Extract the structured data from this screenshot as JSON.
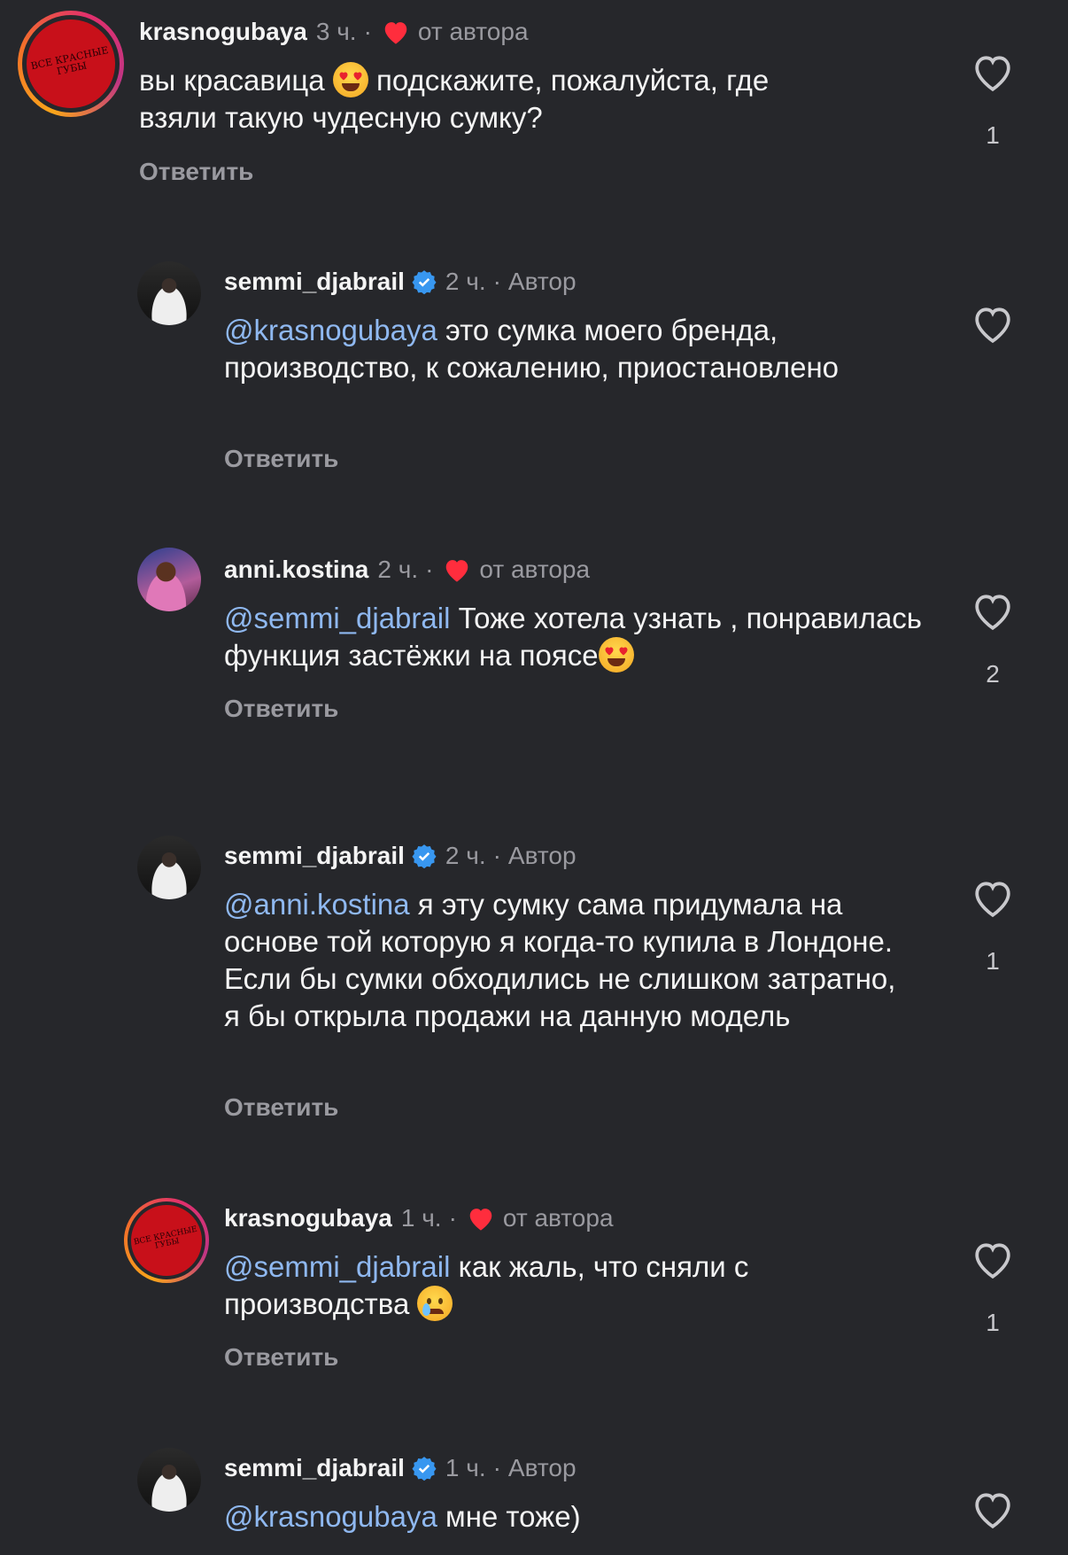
{
  "reply_label": "Ответить",
  "comments": [
    {
      "username": "krasnogubaya",
      "time": "3 ч.",
      "dot": "·",
      "tag": "от автора",
      "avatar_text": "ВСЕ КРАСНЫЕ ГУБЫ",
      "text_before": "вы красавица",
      "emoji": "heart-eyes",
      "text_after": "подскажите, пожалуйста, где взяли такую чудесную сумку?",
      "likes": "1"
    },
    {
      "username": "semmi_djabrail",
      "time": "2 ч.",
      "dot": "·",
      "tag": "Автор",
      "mention": "@krasnogubaya",
      "text": "это сумка моего бренда, производство, к сожалению, приостановлено",
      "likes": ""
    },
    {
      "username": "anni.kostina",
      "time": "2 ч.",
      "dot": "·",
      "tag": "от автора",
      "mention": "@semmi_djabrail",
      "text": "Тоже хотела узнать , понравилась функция застёжки на поясе",
      "emoji": "heart-eyes",
      "likes": "2"
    },
    {
      "username": "semmi_djabrail",
      "time": "2 ч.",
      "dot": "·",
      "tag": "Автор",
      "mention": "@anni.kostina",
      "text": "я эту сумку сама придумала на основе той которую я когда-то купила в Лондоне. Если бы сумки обходились не слишком затратно, я бы открыла продажи на данную модель",
      "likes": "1"
    },
    {
      "username": "krasnogubaya",
      "time": "1 ч.",
      "dot": "·",
      "tag": "от автора",
      "avatar_text": "ВСЕ КРАСНЫЕ ГУБЫ",
      "mention": "@semmi_djabrail",
      "text": "как жаль, что сняли с производства",
      "emoji": "crying",
      "likes": "1"
    },
    {
      "username": "semmi_djabrail",
      "time": "1 ч.",
      "dot": "·",
      "tag": "Автор",
      "mention": "@krasnogubaya",
      "text": "мне тоже)",
      "likes": ""
    }
  ],
  "colors": {
    "background": "#26272b",
    "mention": "#8fb8f0",
    "heart_red": "#ff2d3d",
    "verified_blue": "#3897f0",
    "muted": "#9a9aa0"
  }
}
